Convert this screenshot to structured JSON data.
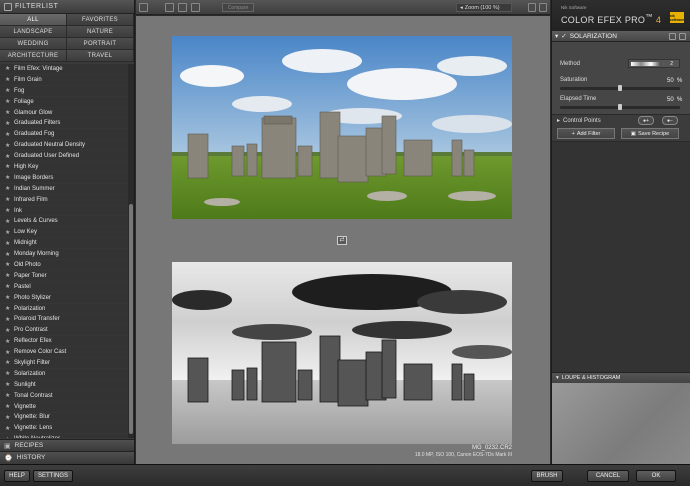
{
  "filterlist": {
    "title": "FILTERLIST",
    "categories": [
      "ALL",
      "FAVORITES",
      "LANDSCAPE",
      "NATURE",
      "WEDDING",
      "PORTRAIT",
      "ARCHITECTURE",
      "TRAVEL"
    ],
    "active_category": "ALL",
    "filters": [
      "Film Efex: Vintage",
      "Film Grain",
      "Fog",
      "Foliage",
      "Glamour Glow",
      "Graduated Filters",
      "Graduated Fog",
      "Graduated Neutral Density",
      "Graduated User Defined",
      "High Key",
      "Image Borders",
      "Indian Summer",
      "Infrared Film",
      "Ink",
      "Levels & Curves",
      "Low Key",
      "Midnight",
      "Monday Morning",
      "Old Photo",
      "Paper Toner",
      "Pastel",
      "Photo Stylizer",
      "Polarization",
      "Polaroid Transfer",
      "Pro Contrast",
      "Reflector Efex",
      "Remove Color Cast",
      "Skylight Filter",
      "Solarization",
      "Sunlight",
      "Tonal Contrast",
      "Vignette",
      "Vignette: Blur",
      "Vignette: Lens",
      "White Neutralizer"
    ]
  },
  "recipes_label": "RECIPES",
  "history_label": "HISTORY",
  "toolbar": {
    "compare_label": "Compare",
    "zoom_label": "Zoom (100 %)"
  },
  "image": {
    "filename": "MG_0232.CR2",
    "info": "18.0 MP, ISO 100, Canon EOS-7Ds Mark III"
  },
  "brand": {
    "sub": "Nik Software",
    "title": "COLOR EFEX PRO",
    "tm": "™",
    "version": "4",
    "logo_text": "nik software"
  },
  "filter_panel": {
    "title": "SOLARIZATION",
    "method_label": "Method",
    "method_value": "2",
    "saturation_label": "Saturation",
    "saturation_value": "50",
    "saturation_level": 0.5,
    "elapsed_label": "Elapsed Time",
    "elapsed_value": "50",
    "elapsed_level": 0.5,
    "percent": "%",
    "control_points_label": "Control Points",
    "add_filter_label": "Add Filter",
    "save_recipe_label": "Save Recipe"
  },
  "loupe_label": "LOUPE & HISTOGRAM",
  "bottom": {
    "help": "HELP",
    "settings": "SETTINGS",
    "brush": "BRUSH",
    "cancel": "CANCEL",
    "ok": "OK"
  },
  "colors": {
    "accent": "#e8b000",
    "bg": "#3a3a3a"
  }
}
